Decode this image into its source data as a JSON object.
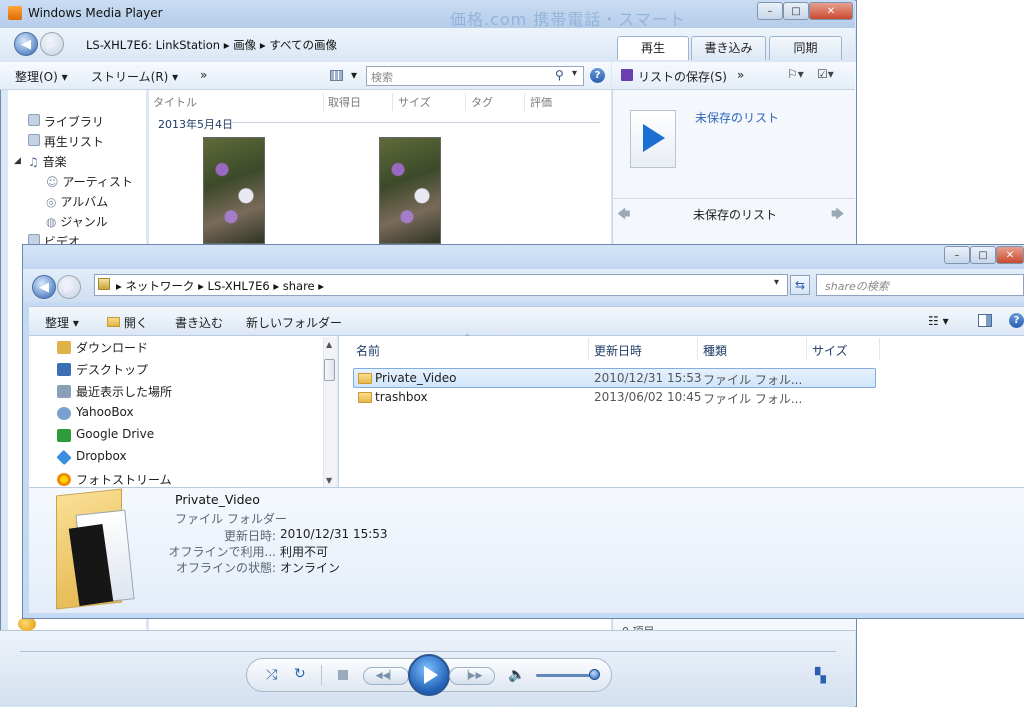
{
  "wmp": {
    "title": "Windows Media Player",
    "watermark": "価格.com  携帯電話・スマート",
    "breadcrumb": [
      "LS-XHL7E6: LinkStation",
      "画像",
      "すべての画像"
    ],
    "tabs": [
      "再生",
      "書き込み",
      "同期"
    ],
    "toolbar": {
      "organize": "整理(O)",
      "stream": "ストリーム(R)",
      "more": "»",
      "search_placeholder": "検索"
    },
    "right_toolbar": {
      "save_list": "リストの保存(S)",
      "more": "»"
    },
    "unsaved_list_link": "未保存のリスト",
    "unsaved_list_nav": "未保存のリスト",
    "item_count": "0 項目",
    "library": [
      {
        "label": "ライブラリ",
        "icon": "library-icon"
      },
      {
        "label": "再生リスト",
        "icon": "playlist-icon"
      },
      {
        "label": "音楽",
        "icon": "music-icon"
      },
      {
        "label": "アーティスト",
        "icon": "artist-icon"
      },
      {
        "label": "アルバム",
        "icon": "album-icon"
      },
      {
        "label": "ジャンル",
        "icon": "genre-icon"
      },
      {
        "label": "ビデオ",
        "icon": "video-icon"
      }
    ],
    "columns": [
      "タイトル",
      "取得日",
      "サイズ",
      "タグ",
      "評価"
    ],
    "group_date": "2013年5月4日",
    "colors": {
      "accent": "#1a6fd0",
      "chrome": "#dbe7f5"
    }
  },
  "explorer": {
    "breadcrumb": [
      "ネットワーク",
      "LS-XHL7E6",
      "share"
    ],
    "search_placeholder": "shareの検索",
    "commands": {
      "organize": "整理",
      "open": "開く",
      "write": "書き込む",
      "new_folder": "新しいフォルダー"
    },
    "favorites": [
      {
        "label": "ダウンロード",
        "icon": "download-folder-icon",
        "color": "#e0b04a"
      },
      {
        "label": "デスクトップ",
        "icon": "desktop-icon",
        "color": "#3a6fb5"
      },
      {
        "label": "最近表示した場所",
        "icon": "recent-places-icon",
        "color": "#8aa0b8"
      },
      {
        "label": "YahooBox",
        "icon": "yahoobox-icon",
        "color": "#7a9fd0"
      },
      {
        "label": "Google Drive",
        "icon": "google-drive-icon",
        "color": "#2f9a3a"
      },
      {
        "label": "Dropbox",
        "icon": "dropbox-icon",
        "color": "#3b8fe0"
      },
      {
        "label": "フォトストリーム",
        "icon": "photostream-icon",
        "color": "#f0b400"
      }
    ],
    "columns": [
      "名前",
      "更新日時",
      "種類",
      "サイズ"
    ],
    "files": [
      {
        "name": "Private_Video",
        "modified": "2010/12/31 15:53",
        "type": "ファイル フォル...",
        "selected": true
      },
      {
        "name": "trashbox",
        "modified": "2013/06/02 10:45",
        "type": "ファイル フォル...",
        "selected": false
      }
    ],
    "details": {
      "name": "Private_Video",
      "kind": "ファイル フォルダー",
      "rows": [
        {
          "label": "更新日時:",
          "value": "2010/12/31 15:53"
        },
        {
          "label": "オフラインで利用...",
          "value": "利用不可"
        },
        {
          "label": "オフラインの状態:",
          "value": "オンライン"
        }
      ]
    }
  }
}
